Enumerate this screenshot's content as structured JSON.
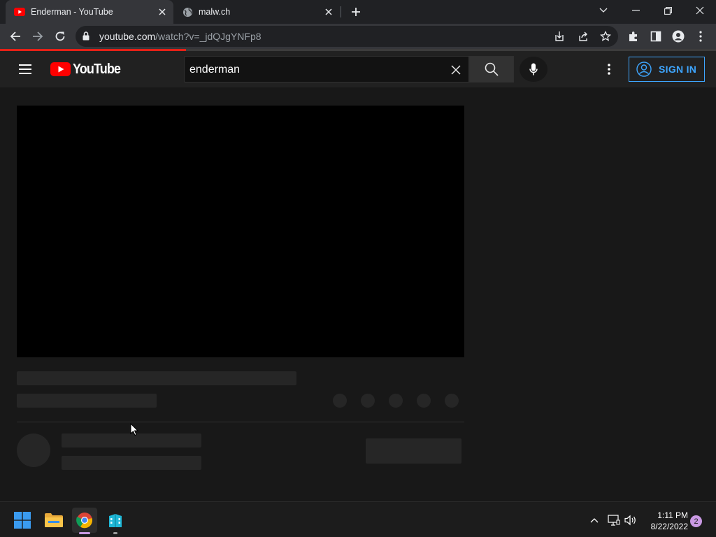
{
  "browser": {
    "tabs": [
      {
        "title": "Enderman - YouTube",
        "active": true,
        "favicon": "youtube-icon"
      },
      {
        "title": "malw.ch",
        "active": false,
        "favicon": "globe-icon"
      }
    ],
    "url": {
      "host": "youtube.com",
      "path": "/watch?v=_jdQJgYNFp8"
    },
    "page_load_progress": 0.26
  },
  "youtube": {
    "logo_text": "YouTube",
    "search": {
      "query": "enderman"
    },
    "sign_in_label": "SIGN IN",
    "colors": {
      "accent": "#3ea6ff",
      "brand_red": "#ff0000"
    }
  },
  "taskbar": {
    "apps": [
      "start",
      "file-explorer",
      "chrome",
      "app"
    ],
    "time": "1:11 PM",
    "date": "8/22/2022",
    "notification_count": "2"
  }
}
